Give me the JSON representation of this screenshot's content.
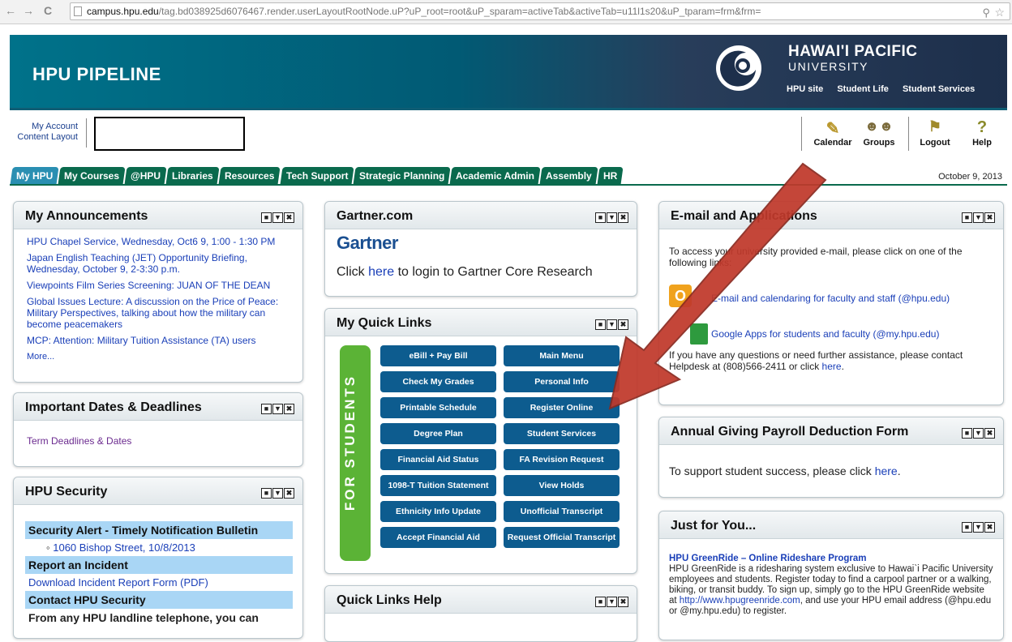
{
  "browser": {
    "url_host": "campus.hpu.edu",
    "url_path": "/tag.bd038925d6076467.render.userLayoutRootNode.uP?uP_root=root&uP_sparam=activeTab&activeTab=u11l1s20&uP_tparam=frm&frm="
  },
  "banner": {
    "title": "HPU PIPELINE",
    "university_line1": "HAWAI'I PACIFIC",
    "university_line2": "UNIVERSITY",
    "links": [
      "HPU site",
      "Student Life",
      "Student Services"
    ]
  },
  "account": {
    "my_account": "My Account",
    "content_layout": "Content Layout"
  },
  "tools": {
    "calendar": "Calendar",
    "groups": "Groups",
    "logout": "Logout",
    "help": "Help"
  },
  "tabs": [
    "My HPU",
    "My Courses",
    "@HPU",
    "Libraries",
    "Resources",
    "Tech Support",
    "Strategic Planning",
    "Academic Admin",
    "Assembly",
    "HR"
  ],
  "date": "October 9, 2013",
  "announcements": {
    "title": "My Announcements",
    "items": [
      "HPU Chapel Service, Wednesday, Oct6 9, 1:00 - 1:30 PM",
      "Japan English Teaching (JET) Opportunity Briefing, Wednesday, October 9, 2-3:30 p.m.",
      "Viewpoints Film Series Screening: JUAN OF THE DEAN",
      "Global Issues Lecture: A discussion on the Price of Peace: Military Perspectives, talking about how the military can become peacemakers",
      "MCP: Attention: Military Tuition Assistance (TA) users"
    ],
    "more": "More..."
  },
  "dates": {
    "title": "Important Dates & Deadlines",
    "link": "Term Deadlines & Dates"
  },
  "security": {
    "title": "HPU Security",
    "alert_heading": "Security Alert - Timely Notification Bulletin",
    "alert_item": "1060 Bishop Street, 10/8/2013",
    "report_heading": "Report an Incident",
    "report_link": "Download Incident Report Form (PDF)",
    "contact_heading": "Contact HPU Security",
    "contact_text": "From any HPU landline telephone, you can"
  },
  "gartner": {
    "title": "Gartner.com",
    "logo": "Gartner",
    "text_before": "Click ",
    "link": "here",
    "text_after": " to login to Gartner Core Research"
  },
  "quicklinks": {
    "title": "My Quick Links",
    "side_label": "FOR STUDENTS",
    "left": [
      "eBill + Pay Bill",
      "Check My Grades",
      "Printable Schedule",
      "Degree Plan",
      "Financial Aid Status",
      "1098-T Tuition Statement",
      "Ethnicity Info Update",
      "Accept Financial Aid"
    ],
    "right": [
      "Main Menu",
      "Personal Info",
      "Register Online",
      "Student Services",
      "FA Revision Request",
      "View Holds",
      "Unofficial Transcript",
      "Request Official Transcript"
    ]
  },
  "qlhelp": {
    "title": "Quick Links Help"
  },
  "email": {
    "title": "E-mail and Applications",
    "intro": "To access your university provided e-mail, please click on one of the following links:",
    "outlook_link": "E-mail and calendaring for faculty and staff (@hpu.edu)",
    "google_link": "Google Apps for students and faculty (@my.hpu.edu)",
    "help_text": "If you have any questions or need further assistance, please contact Helpdesk at (808)566-2411 or click ",
    "help_link": "here",
    "help_end": "."
  },
  "giving": {
    "title": "Annual Giving Payroll Deduction Form",
    "text": "To support student success, please click ",
    "link": "here",
    "end": "."
  },
  "foryou": {
    "title": "Just for You...",
    "heading": "HPU GreenRide – Online Rideshare Program",
    "text1": "HPU GreenRide is a ridesharing system exclusive to Hawai`i Pacific University employees and students. Register today to find a carpool partner or a walking, biking, or transit buddy. To sign up, simply go to the HPU GreenRide website at ",
    "link": "http://www.hpugreenride.com",
    "text2": ", and use your HPU email address (@hpu.edu or @my.hpu.edu) to register."
  },
  "colors": {
    "banner_teal": "#00728a",
    "tab_green": "#0a6a4d",
    "tab_active": "#2a8fb2",
    "button_blue": "#0d5c8f",
    "student_green": "#5bb336",
    "arrow_red": "#c0392b"
  }
}
